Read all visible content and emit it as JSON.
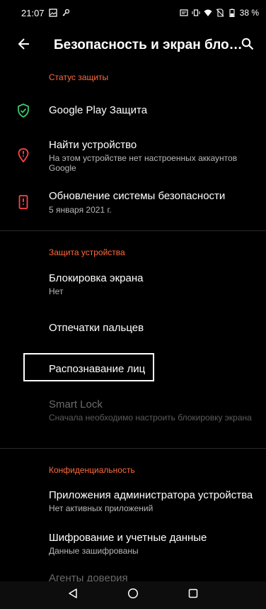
{
  "status_bar": {
    "time": "21:07",
    "battery": "38 %"
  },
  "app_bar": {
    "title": "Безопасность и экран блоки…"
  },
  "sections": {
    "protection_status": "Статус защиты",
    "device_protection": "Защита устройства",
    "privacy": "Конфиденциальность"
  },
  "items": {
    "play_protect": {
      "title": "Google Play Защита"
    },
    "find_device": {
      "title": "Найти устройство",
      "summary": "На этом устройстве нет настроенных аккаунтов Google"
    },
    "security_update": {
      "title": "Обновление системы безопасности",
      "summary": "5 января 2021 г."
    },
    "screen_lock": {
      "title": "Блокировка экрана",
      "summary": "Нет"
    },
    "fingerprints": {
      "title": "Отпечатки пальцев"
    },
    "face_recognition": {
      "title": "Распознавание лиц"
    },
    "smart_lock": {
      "title": "Smart Lock",
      "summary": "Сначала необходимо настроить блокировку экрана"
    },
    "device_admin": {
      "title": "Приложения администратора устройства",
      "summary": "Нет активных приложений"
    },
    "encryption": {
      "title": "Шифрование и учетные данные",
      "summary": "Данные зашифрованы"
    },
    "trust_agents": {
      "title": "Агенты доверия"
    }
  },
  "colors": {
    "accent": "#ff6a3d",
    "shield_green": "#3ec46d",
    "alert_red": "#ff4444"
  },
  "icons": [
    "back-arrow-icon",
    "search-icon",
    "shield-check-icon",
    "location-alert-icon",
    "phone-alert-icon",
    "nav-back-icon",
    "nav-home-icon",
    "nav-recents-icon"
  ]
}
